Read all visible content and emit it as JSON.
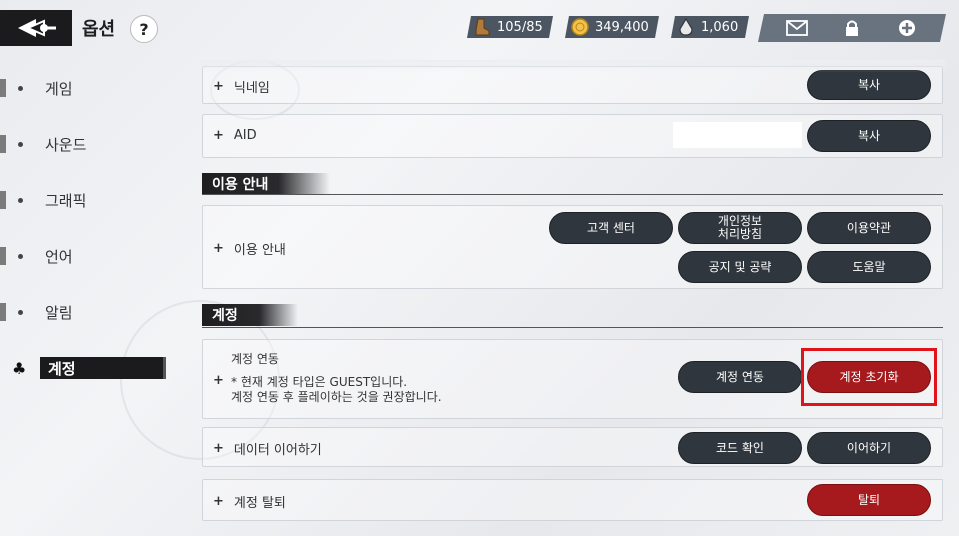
{
  "header": {
    "title": "옵션",
    "help_label": "?",
    "resources": [
      {
        "name": "stamina",
        "icon": "boot-icon",
        "value": "105/85"
      },
      {
        "name": "gold",
        "icon": "coin-icon",
        "value": "349,400"
      },
      {
        "name": "gem",
        "icon": "gem-icon",
        "value": "1,060"
      }
    ],
    "icons": [
      "mail-icon",
      "lock-icon",
      "add-circle-icon"
    ]
  },
  "sidebar": {
    "items": [
      {
        "label": "게임"
      },
      {
        "label": "사운드"
      },
      {
        "label": "그래픽"
      },
      {
        "label": "언어"
      },
      {
        "label": "알림"
      },
      {
        "label": "계정",
        "active": true
      }
    ]
  },
  "main": {
    "nickname_row": {
      "label": "닉네임",
      "button": "복사"
    },
    "aid_row": {
      "label": "AID",
      "value": "",
      "button": "복사"
    },
    "usage_section": {
      "title": "이용 안내",
      "row_label": "이용 안내",
      "buttons": {
        "support": "고객 센터",
        "privacy": "개인정보\n처리방침",
        "terms": "이용약관",
        "notice": "공지 및 공략",
        "help": "도움말"
      }
    },
    "account_section": {
      "title": "계정",
      "link_row": {
        "title": "계정 연동",
        "note_line1": "* 현재 계정 타입은 GUEST입니다.",
        "note_line2": "계정 연동 후 플레이하는 것을 권장합니다.",
        "link_button": "계정 연동",
        "reset_button": "계정 초기화"
      },
      "continue_row": {
        "label": "데이터 이어하기",
        "code_button": "코드 확인",
        "continue_button": "이어하기"
      },
      "withdraw_row": {
        "label": "계정 탈퇴",
        "button": "탈퇴"
      }
    }
  },
  "colors": {
    "dark_button": "#2f363d",
    "red_button": "#a6191c",
    "highlight": "#e1141b"
  }
}
